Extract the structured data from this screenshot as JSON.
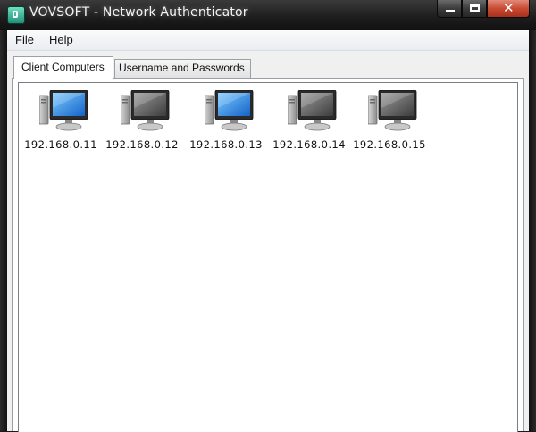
{
  "window": {
    "title": "VOVSOFT - Network Authenticator"
  },
  "menu": {
    "file": "File",
    "help": "Help"
  },
  "tabs": [
    {
      "label": "Client Computers",
      "active": true
    },
    {
      "label": "Username and Passwords",
      "active": false
    }
  ],
  "computers": [
    {
      "ip": "192.168.0.11",
      "status": "online",
      "screen_color": "#3aa0f0"
    },
    {
      "ip": "192.168.0.12",
      "status": "offline",
      "screen_color": "#6a6a6a"
    },
    {
      "ip": "192.168.0.13",
      "status": "online",
      "screen_color": "#3aa0f0"
    },
    {
      "ip": "192.168.0.14",
      "status": "offline",
      "screen_color": "#6a6a6a"
    },
    {
      "ip": "192.168.0.15",
      "status": "offline",
      "screen_color": "#6a6a6a"
    }
  ],
  "icons": {
    "app": "app-icon",
    "computer": "computer-icon",
    "minimize": "minimize-icon",
    "maximize": "maximize-icon",
    "close": "close-icon"
  }
}
